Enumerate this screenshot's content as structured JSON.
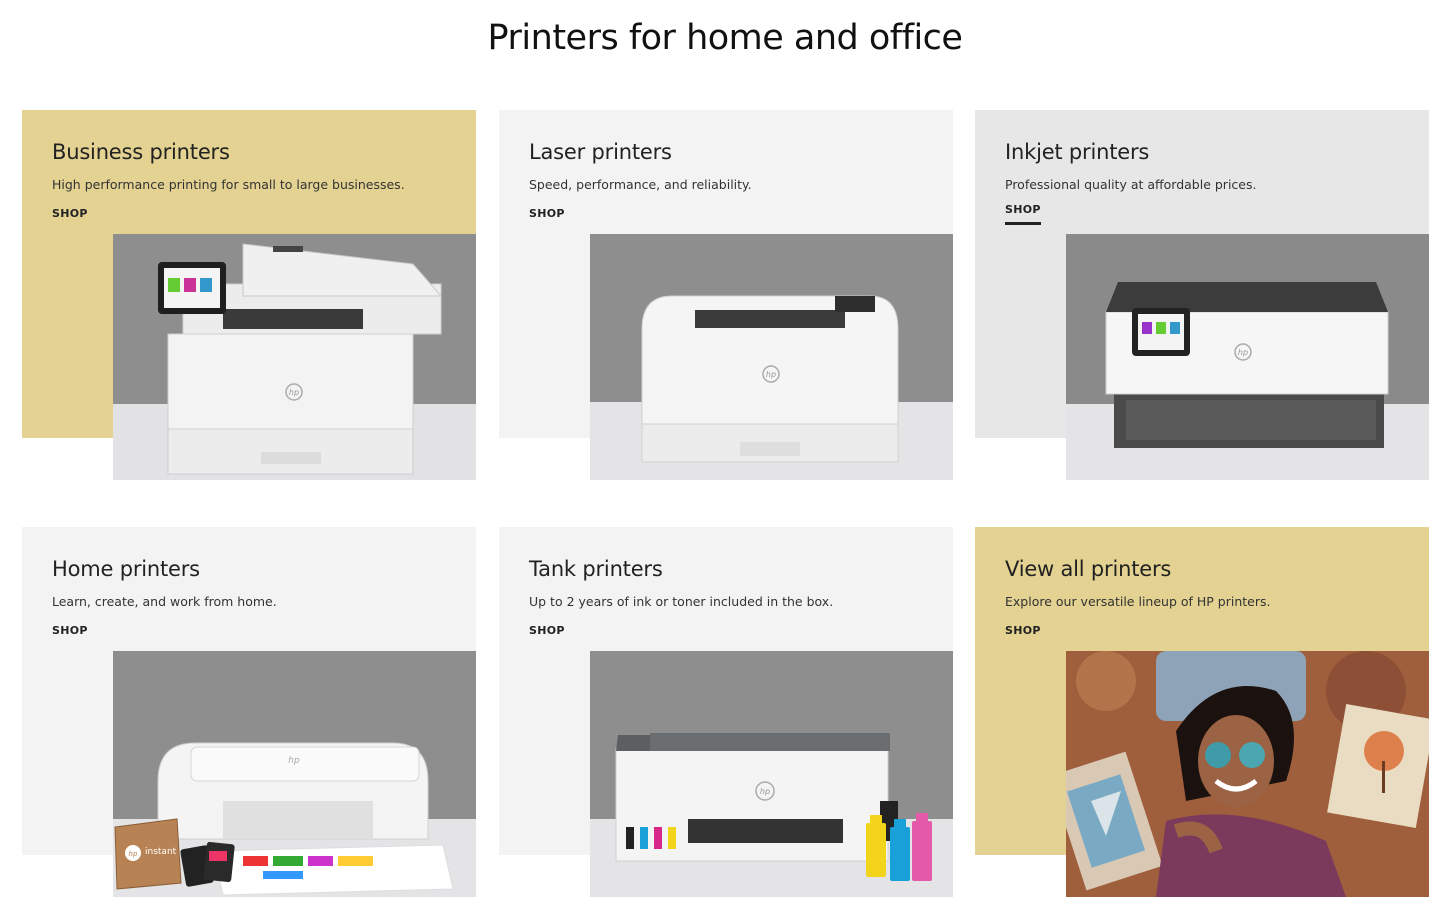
{
  "page": {
    "title": "Printers for home and office"
  },
  "colors": {
    "gold_panel": "#e3d291",
    "light_panel": "#f3f3f3",
    "grey_panel": "#e7e7e7",
    "photo_backdrop": "#8e8e8e",
    "photo_floor": "#e4e4e6"
  },
  "cards": [
    {
      "title": "Business printers",
      "description": "High performance printing for small to large businesses.",
      "shop_label": "SHOP",
      "image": "business-printer-image"
    },
    {
      "title": "Laser printers",
      "description": "Speed, performance, and reliability.",
      "shop_label": "SHOP",
      "image": "laser-printer-image"
    },
    {
      "title": "Inkjet printers",
      "description": "Professional quality at affordable prices.",
      "shop_label": "SHOP",
      "image": "inkjet-printer-image"
    },
    {
      "title": "Home printers",
      "description": "Learn, create, and work from home.",
      "shop_label": "SHOP",
      "image": "home-printer-image"
    },
    {
      "title": "Tank printers",
      "description": "Up to 2 years of ink or toner included in the box.",
      "shop_label": "SHOP",
      "image": "tank-printer-image"
    },
    {
      "title": "View all printers",
      "description": "Explore our versatile lineup of HP printers.",
      "shop_label": "SHOP",
      "image": "lifestyle-photo-image"
    }
  ],
  "logos": {
    "hp": "hp",
    "instant_ink": "instant ink"
  }
}
